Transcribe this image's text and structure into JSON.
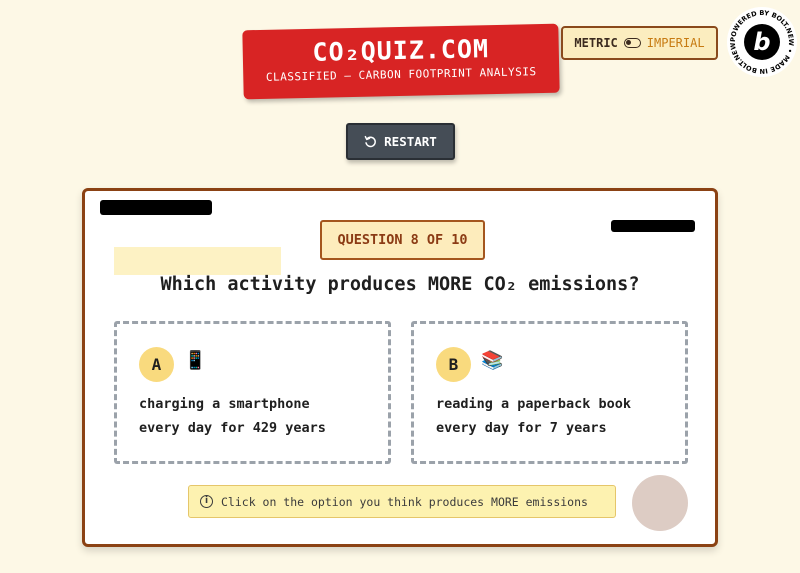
{
  "header": {
    "logo_title": "CO₂QUIZ.COM",
    "logo_subtitle": "CLASSIFIED – CARBON FOOTPRINT ANALYSIS",
    "unit_metric": "METRIC",
    "unit_imperial": "IMPERIAL",
    "badge_text": "POWERED BY BOLT.NEW • MADE IN BOLT.NEW •",
    "badge_letter": "b"
  },
  "controls": {
    "restart_label": "RESTART",
    "restart_icon": "restart-icon"
  },
  "quiz": {
    "progress": "QUESTION 8 OF 10",
    "question": "Which activity produces MORE CO₂ emissions?",
    "options": [
      {
        "letter": "A",
        "icon": "📱",
        "line1": "charging a smartphone",
        "line2": "every day for 429 years"
      },
      {
        "letter": "B",
        "icon": "📚",
        "line1": "reading a paperback book",
        "line2": "every day for 7 years"
      }
    ],
    "hint": "Click on the option you think produces MORE emissions"
  },
  "colors": {
    "background": "#fdf8e6",
    "logo": "#d82424",
    "card_border": "#8b4214",
    "badge_bg": "#fdecbc",
    "letter_bg": "#f9da7e",
    "hint_bg": "#fdf2b0"
  }
}
